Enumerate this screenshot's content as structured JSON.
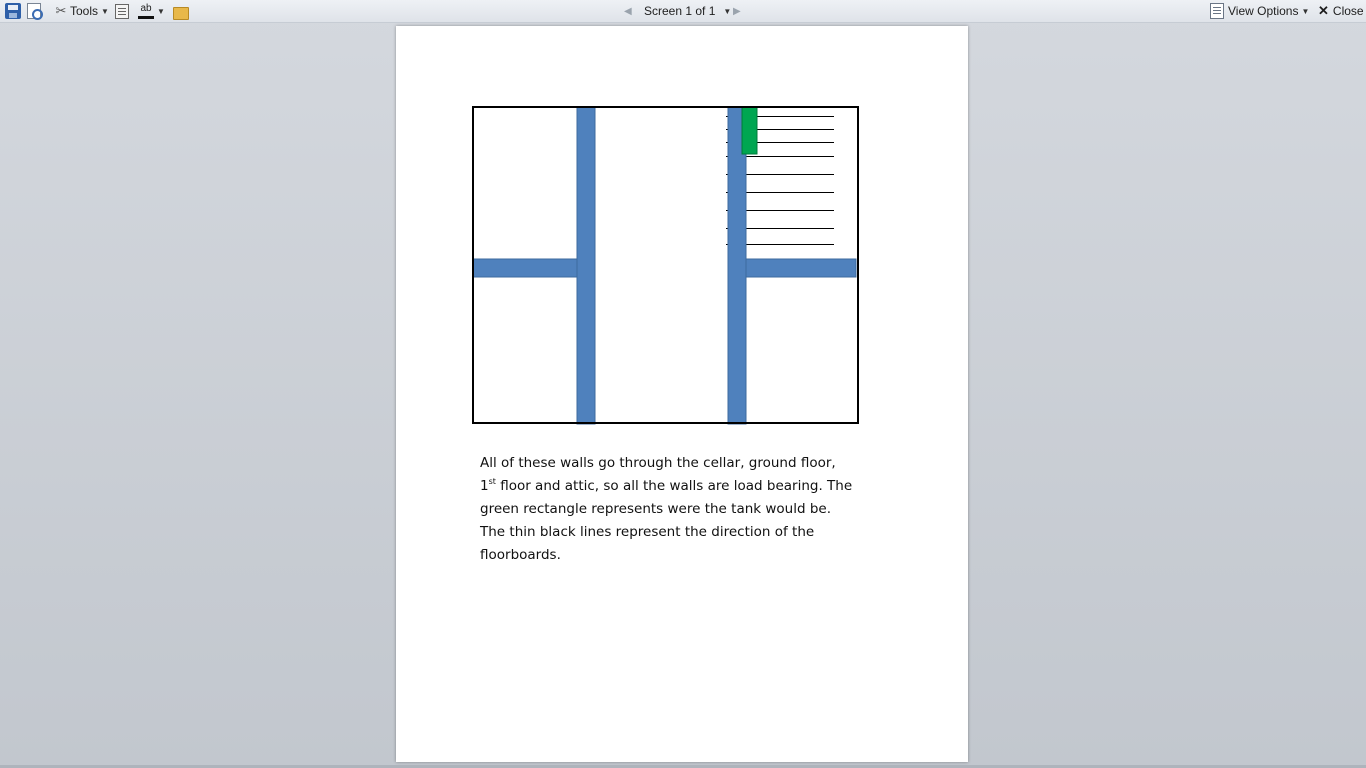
{
  "toolbar": {
    "tools_label": "Tools",
    "screen_label": "Screen 1 of 1",
    "view_options_label": "View Options",
    "close_label": "Close",
    "spell_glyph": "ab"
  },
  "document": {
    "caption_part1": "All of these walls go through the cellar, ground floor, 1",
    "caption_sup": "st",
    "caption_part2": " floor and attic, so all the walls are load bearing. The green rectangle represents were the tank would be. The thin black lines represent the direction of the floorboards."
  },
  "colors": {
    "wall_blue": "#4f81bd",
    "tank_green": "#00a651",
    "outline": "#000000"
  }
}
